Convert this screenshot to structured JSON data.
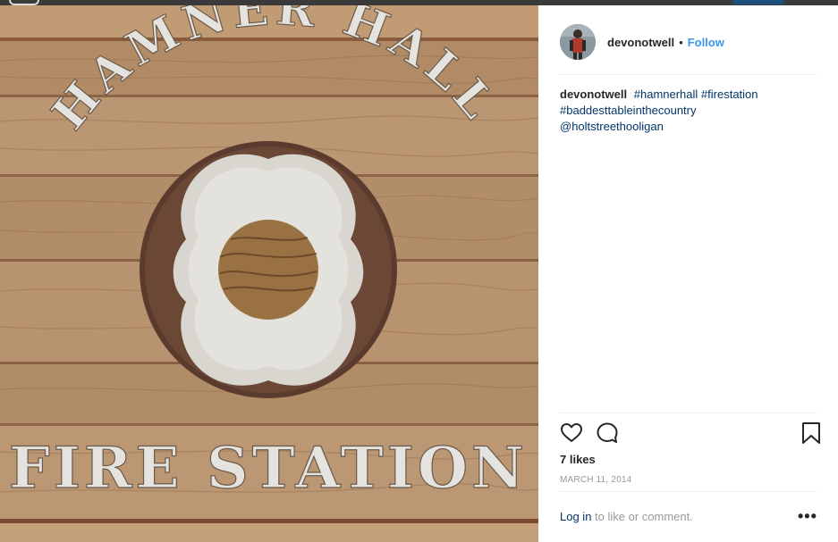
{
  "post": {
    "author": "devonotwell",
    "separator": "•",
    "follow_label": "Follow",
    "caption": {
      "author": "devonotwell",
      "hashtags": [
        "#hamnerhall",
        "#firestation",
        "#baddesttableinthecountry",
        "@holtstreethooligan"
      ]
    },
    "likes": "7 likes",
    "date": "MARCH 11, 2014",
    "login_link": "Log in",
    "login_text": " to like or comment.",
    "more_label": "•••"
  },
  "photo": {
    "top_text": "HAMNER HALL",
    "bottom_text": "FIRE STATION"
  },
  "icons": {
    "heart": "heart-icon",
    "comment": "comment-icon",
    "bookmark": "bookmark-icon"
  },
  "colors": {
    "link": "#003569",
    "follow": "#3897f0",
    "text": "#262626",
    "muted": "#999999"
  }
}
